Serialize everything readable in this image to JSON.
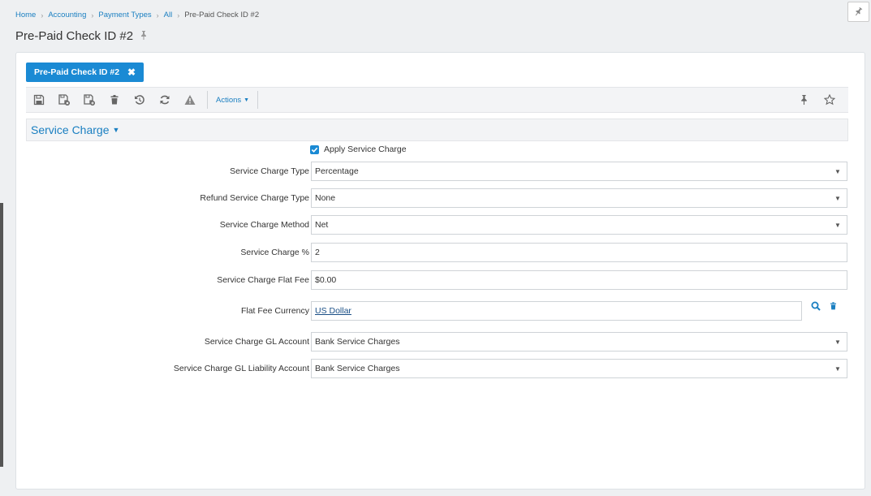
{
  "breadcrumb": {
    "items": [
      "Home",
      "Accounting",
      "Payment Types",
      "All"
    ],
    "current": "Pre-Paid Check ID #2"
  },
  "page": {
    "title": "Pre-Paid Check ID #2"
  },
  "tab": {
    "label": "Pre-Paid Check ID #2"
  },
  "toolbar": {
    "actions_label": "Actions",
    "icons": [
      "save-icon",
      "save-close-icon",
      "save-new-icon",
      "delete-icon",
      "undo-icon",
      "refresh-icon",
      "warning-icon",
      "pin-icon",
      "star-icon"
    ]
  },
  "section": {
    "title": "Service Charge"
  },
  "form": {
    "apply_service_charge": {
      "label": "Apply Service Charge",
      "checked": true
    },
    "service_charge_type": {
      "label": "Service Charge Type",
      "value": "Percentage"
    },
    "refund_service_charge_type": {
      "label": "Refund Service Charge Type",
      "value": "None"
    },
    "service_charge_method": {
      "label": "Service Charge Method",
      "value": "Net"
    },
    "service_charge_percent": {
      "label": "Service Charge %",
      "value": "2"
    },
    "service_charge_flat_fee": {
      "label": "Service Charge Flat Fee",
      "value": "$0.00"
    },
    "flat_fee_currency": {
      "label": "Flat Fee Currency",
      "value": "US Dollar"
    },
    "service_charge_gl_account": {
      "label": "Service Charge GL Account",
      "value": "Bank Service Charges"
    },
    "service_charge_gl_liability_account": {
      "label": "Service Charge GL Liability Account",
      "value": "Bank Service Charges"
    }
  },
  "colors": {
    "accent": "#1a8ad4",
    "link": "#1a7fc1"
  }
}
